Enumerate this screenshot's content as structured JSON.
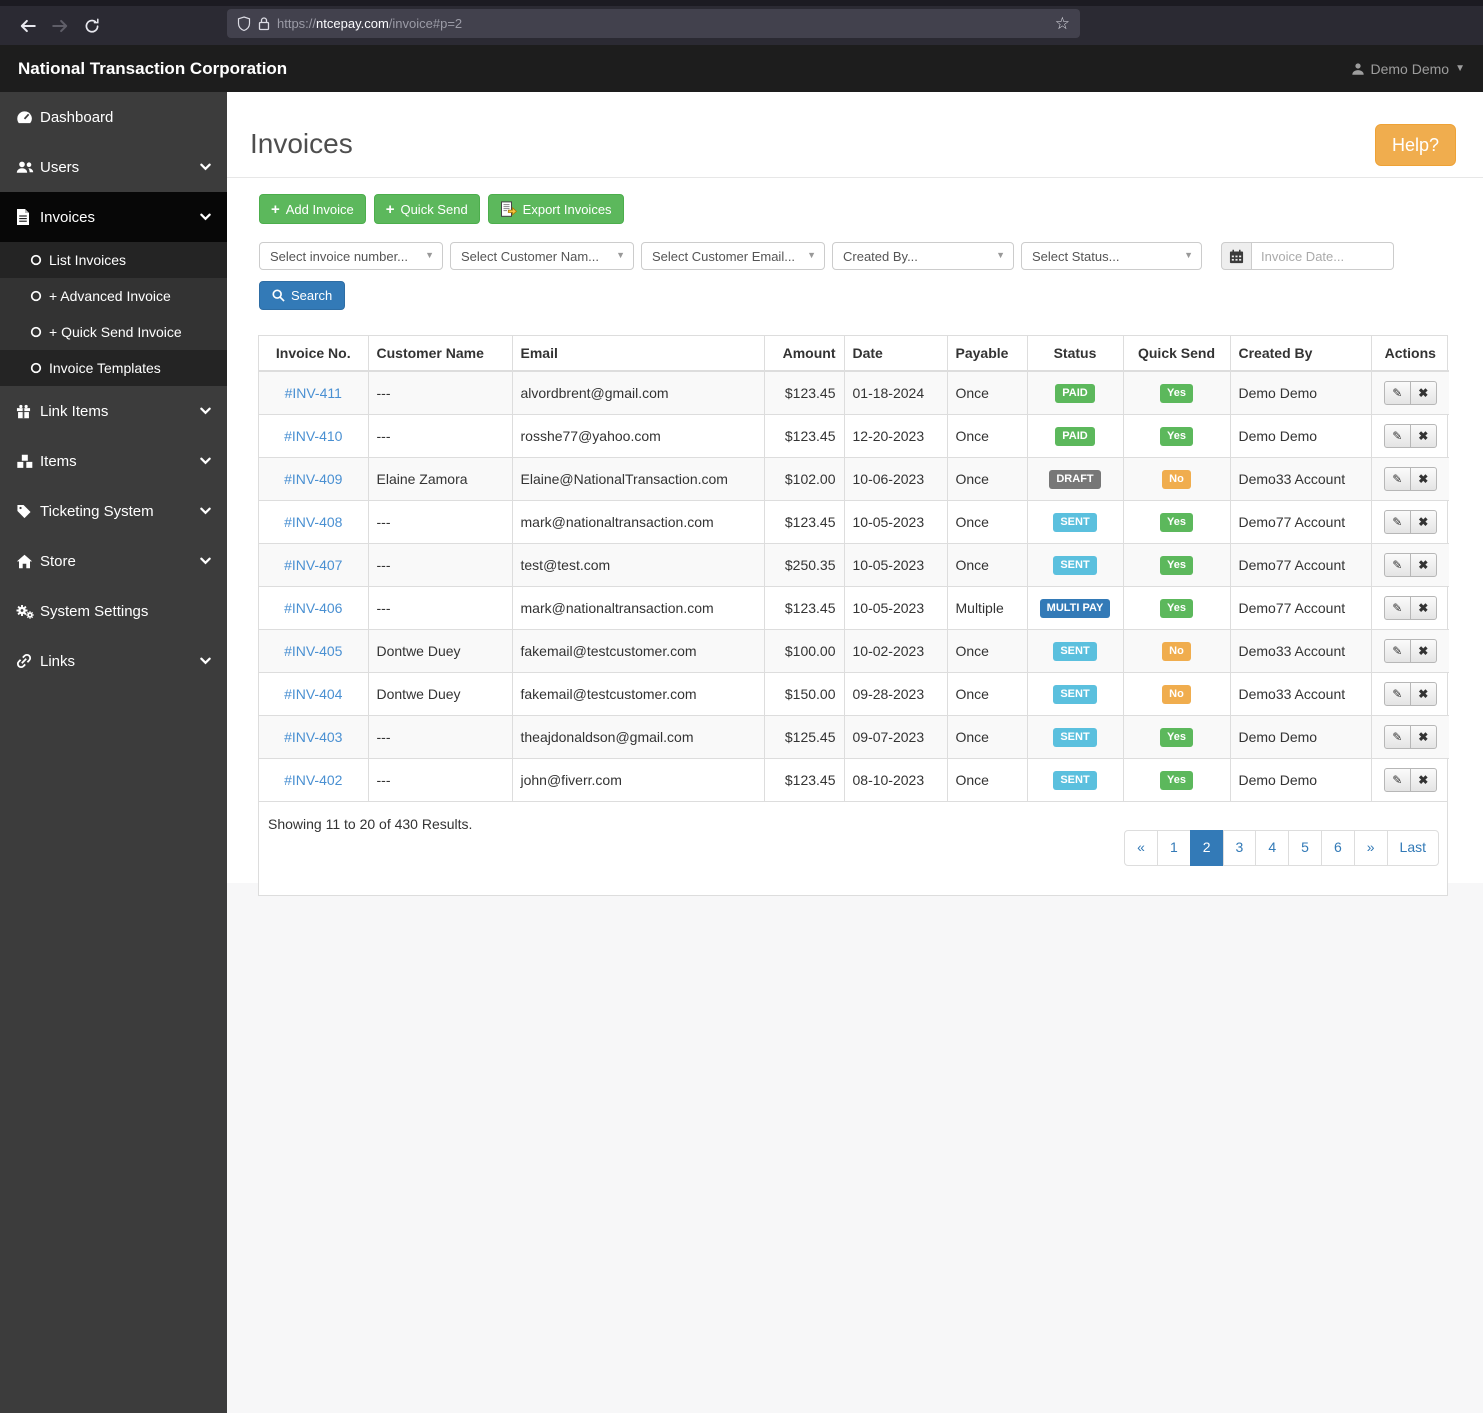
{
  "browser": {
    "url_scheme": "https://",
    "url_domain": "ntcepay.com",
    "url_path": "/invoice#p=2"
  },
  "navbar": {
    "brand": "National Transaction Corporation",
    "user": "Demo Demo"
  },
  "sidebar": {
    "dashboard": "Dashboard",
    "users": "Users",
    "invoices": "Invoices",
    "list_invoices": "List Invoices",
    "advanced_invoice": "+ Advanced Invoice",
    "quick_send_invoice": "+ Quick Send Invoice",
    "invoice_templates": "Invoice Templates",
    "link_items": "Link Items",
    "items": "Items",
    "ticketing": "Ticketing System",
    "store": "Store",
    "system_settings": "System Settings",
    "links": "Links"
  },
  "page": {
    "title": "Invoices",
    "help": "Help?"
  },
  "toolbar": {
    "add_invoice": "Add Invoice",
    "quick_send": "Quick Send",
    "export_invoices": "Export Invoices"
  },
  "filters": {
    "invoice_number": "Select invoice number...",
    "customer_name": "Select Customer Nam...",
    "customer_email": "Select Customer Email...",
    "created_by": "Created By...",
    "status": "Select Status...",
    "date_placeholder": "Invoice Date...",
    "search": "Search"
  },
  "table": {
    "columns": [
      "Invoice No.",
      "Customer Name",
      "Email",
      "Amount",
      "Date",
      "Payable",
      "Status",
      "Quick Send",
      "Created By",
      "Actions"
    ],
    "rows": [
      {
        "no": "#INV-411",
        "customer": "---",
        "email": "alvordbrent@gmail.com",
        "amount": "$123.45",
        "date": "01-18-2024",
        "payable": "Once",
        "status": "PAID",
        "status_color": "green",
        "quick_send": "Yes",
        "quick_send_color": "green",
        "created_by": "Demo Demo"
      },
      {
        "no": "#INV-410",
        "customer": "---",
        "email": "rosshe77@yahoo.com",
        "amount": "$123.45",
        "date": "12-20-2023",
        "payable": "Once",
        "status": "PAID",
        "status_color": "green",
        "quick_send": "Yes",
        "quick_send_color": "green",
        "created_by": "Demo Demo"
      },
      {
        "no": "#INV-409",
        "customer": "Elaine Zamora",
        "email": "Elaine@NationalTransaction.com",
        "amount": "$102.00",
        "date": "10-06-2023",
        "payable": "Once",
        "status": "DRAFT",
        "status_color": "gray",
        "quick_send": "No",
        "quick_send_color": "orange",
        "created_by": "Demo33 Account"
      },
      {
        "no": "#INV-408",
        "customer": "---",
        "email": "mark@nationaltransaction.com",
        "amount": "$123.45",
        "date": "10-05-2023",
        "payable": "Once",
        "status": "SENT",
        "status_color": "lightblue",
        "quick_send": "Yes",
        "quick_send_color": "green",
        "created_by": "Demo77 Account"
      },
      {
        "no": "#INV-407",
        "customer": "---",
        "email": "test@test.com",
        "amount": "$250.35",
        "date": "10-05-2023",
        "payable": "Once",
        "status": "SENT",
        "status_color": "lightblue",
        "quick_send": "Yes",
        "quick_send_color": "green",
        "created_by": "Demo77 Account"
      },
      {
        "no": "#INV-406",
        "customer": "---",
        "email": "mark@nationaltransaction.com",
        "amount": "$123.45",
        "date": "10-05-2023",
        "payable": "Multiple",
        "status": "MULTI PAY",
        "status_color": "blue",
        "quick_send": "Yes",
        "quick_send_color": "green",
        "created_by": "Demo77 Account"
      },
      {
        "no": "#INV-405",
        "customer": "Dontwe Duey",
        "email": "fakemail@testcustomer.com",
        "amount": "$100.00",
        "date": "10-02-2023",
        "payable": "Once",
        "status": "SENT",
        "status_color": "lightblue",
        "quick_send": "No",
        "quick_send_color": "orange",
        "created_by": "Demo33 Account"
      },
      {
        "no": "#INV-404",
        "customer": "Dontwe Duey",
        "email": "fakemail@testcustomer.com",
        "amount": "$150.00",
        "date": "09-28-2023",
        "payable": "Once",
        "status": "SENT",
        "status_color": "lightblue",
        "quick_send": "No",
        "quick_send_color": "orange",
        "created_by": "Demo33 Account"
      },
      {
        "no": "#INV-403",
        "customer": "---",
        "email": "theajdonaldson@gmail.com",
        "amount": "$125.45",
        "date": "09-07-2023",
        "payable": "Once",
        "status": "SENT",
        "status_color": "lightblue",
        "quick_send": "Yes",
        "quick_send_color": "green",
        "created_by": "Demo Demo"
      },
      {
        "no": "#INV-402",
        "customer": "---",
        "email": "john@fiverr.com",
        "amount": "$123.45",
        "date": "08-10-2023",
        "payable": "Once",
        "status": "SENT",
        "status_color": "lightblue",
        "quick_send": "Yes",
        "quick_send_color": "green",
        "created_by": "Demo Demo"
      }
    ],
    "summary": "Showing 11 to 20 of 430 Results."
  },
  "pagination": {
    "prev": "«",
    "pages": [
      "1",
      "2",
      "3",
      "4",
      "5",
      "6"
    ],
    "active": "2",
    "next": "»",
    "last": "Last"
  },
  "colors": {
    "success_green": "#5cb85c",
    "info_lightblue": "#5bc0de",
    "primary_blue": "#337ab7",
    "warning_orange": "#f0ad4e",
    "draft_gray": "#777777",
    "navbar_dark": "#1d1d1d",
    "sidebar_gray": "#3c3c3c",
    "link_blue": "#4a90d2"
  }
}
